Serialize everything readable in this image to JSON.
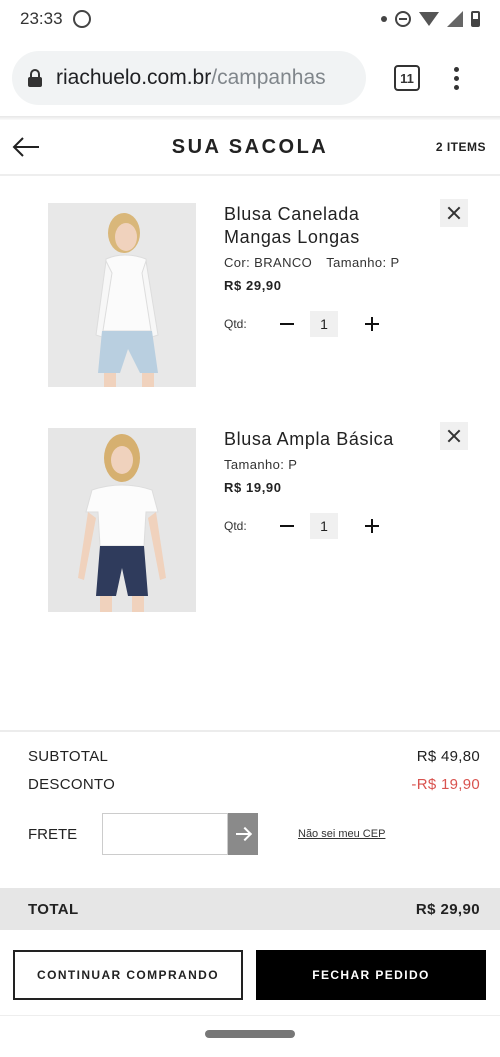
{
  "status_bar": {
    "time": "23:33"
  },
  "browser": {
    "url_domain": "riachuelo.com.br",
    "url_path": "/campanhas",
    "tab_count": "11"
  },
  "header": {
    "title": "SUA SACOLA",
    "item_count": "2 ITEMS"
  },
  "products": [
    {
      "name_line1": "Blusa Canelada",
      "name_line2": "Mangas Longas",
      "color": "Cor: BRANCO",
      "size": "Tamanho: P",
      "price": "R$ 29,90",
      "qty_label": "Qtd:",
      "qty": "1"
    },
    {
      "name_line1": "Blusa Ampla Básica",
      "name_line2": "",
      "color": "",
      "size": "Tamanho: P",
      "price": "R$ 19,90",
      "qty_label": "Qtd:",
      "qty": "1"
    }
  ],
  "summary": {
    "subtotal_label": "SUBTOTAL",
    "subtotal_value": "R$ 49,80",
    "discount_label": "DESCONTO",
    "discount_value": "-R$ 19,90",
    "shipping_label": "FRETE",
    "shipping_placeholder": "",
    "unknown_cep_link": "Não sei meu CEP",
    "total_label": "TOTAL",
    "total_value": "R$ 29,90"
  },
  "actions": {
    "continue_label": "CONTINUAR COMPRANDO",
    "checkout_label": "FECHAR PEDIDO"
  },
  "colors": {
    "discount": "#d9534f",
    "checkout_bg": "#000000",
    "total_bar_bg": "#e6e6e6"
  }
}
